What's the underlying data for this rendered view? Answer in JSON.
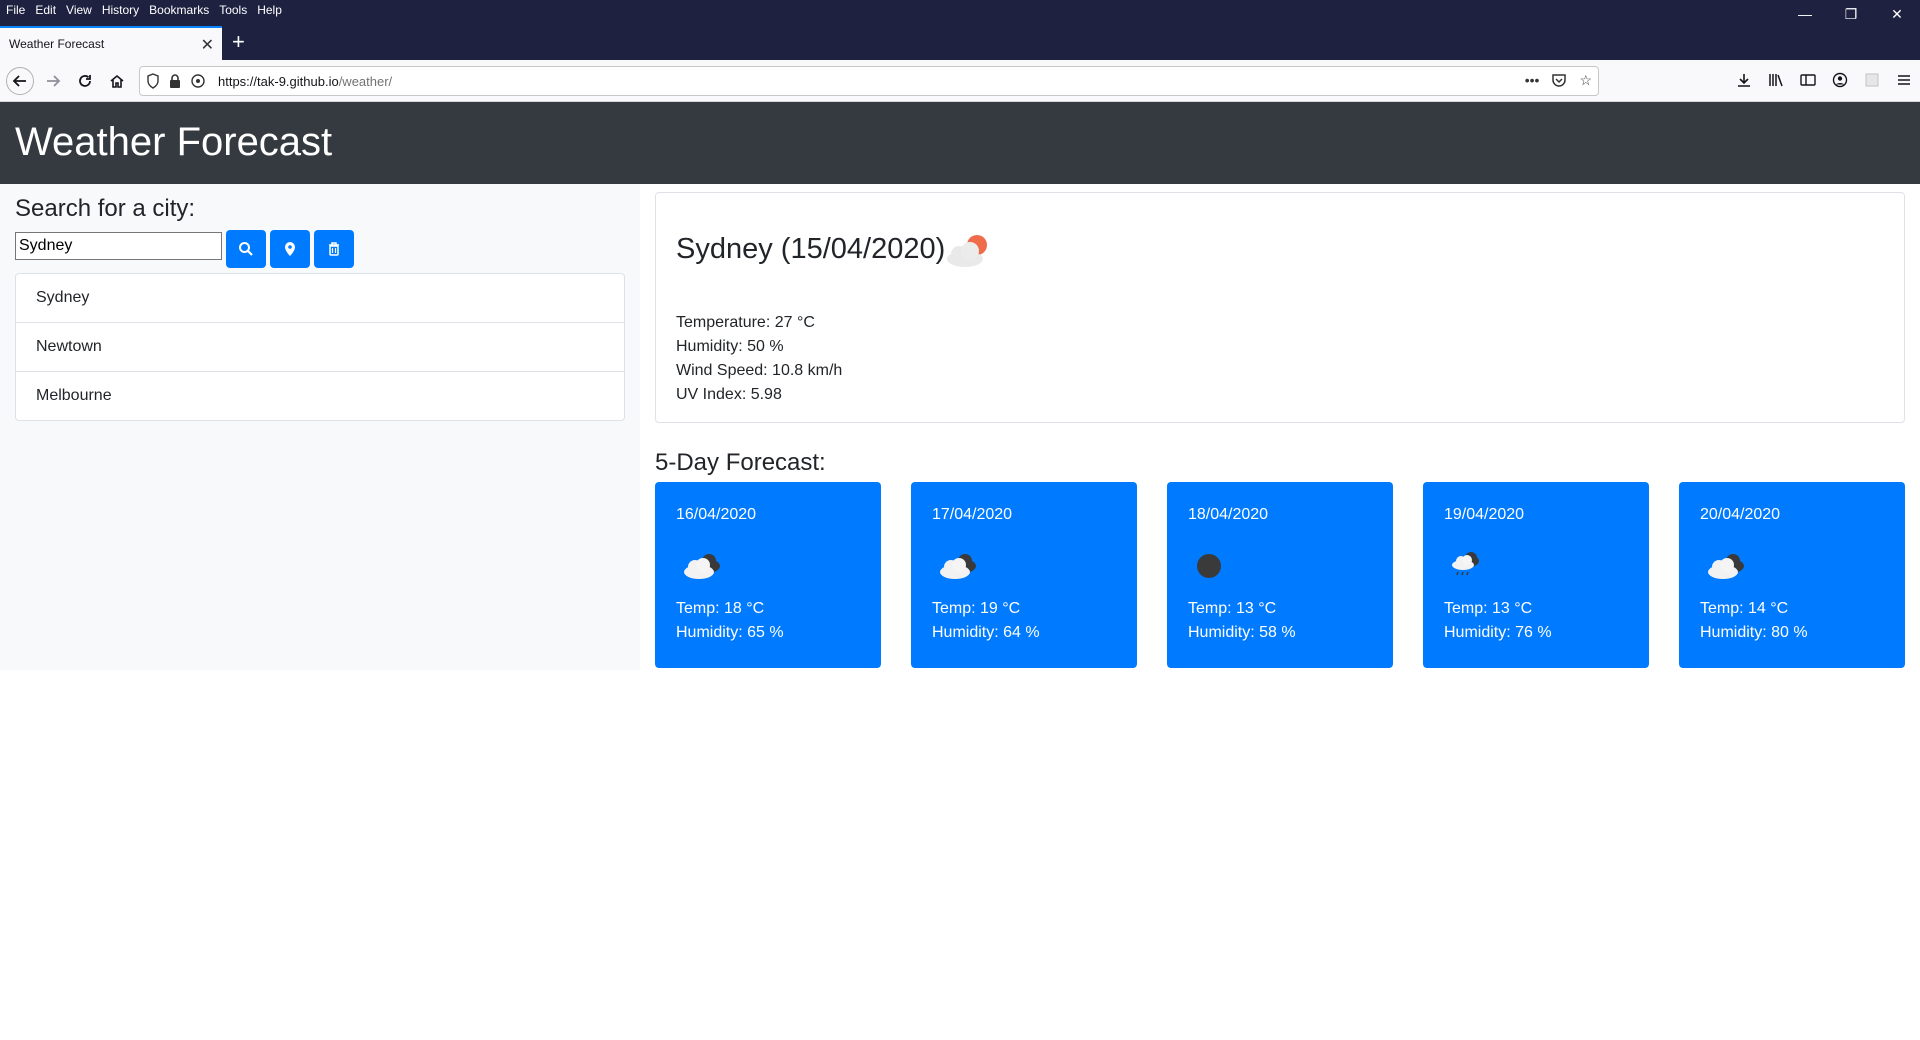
{
  "browser": {
    "menu": [
      "File",
      "Edit",
      "View",
      "History",
      "Bookmarks",
      "Tools",
      "Help"
    ],
    "tab_title": "Weather Forecast",
    "url_domain": "https://tak-9.github.io",
    "url_path": "/weather/"
  },
  "app": {
    "title": "Weather Forecast"
  },
  "search": {
    "label": "Search for a city:",
    "input_value": "Sydney",
    "history": [
      "Sydney",
      "Newtown",
      "Melbourne"
    ]
  },
  "current": {
    "heading": "Sydney (15/04/2020)",
    "icon": "cloud-sun-icon",
    "temperature": "Temperature: 27 °C",
    "humidity": "Humidity: 50 %",
    "wind": "Wind Speed: 10.8 km/h",
    "uv": "UV Index: 5.98"
  },
  "forecast": {
    "title": "5-Day Forecast:",
    "days": [
      {
        "date": "16/04/2020",
        "icon": "broken-clouds-icon",
        "temp": "Temp: 18 °C",
        "humidity": "Humidity: 65 %"
      },
      {
        "date": "17/04/2020",
        "icon": "broken-clouds-icon",
        "temp": "Temp: 19 °C",
        "humidity": "Humidity: 64 %"
      },
      {
        "date": "18/04/2020",
        "icon": "clear-night-icon",
        "temp": "Temp: 13 °C",
        "humidity": "Humidity: 58 %"
      },
      {
        "date": "19/04/2020",
        "icon": "light-rain-icon",
        "temp": "Temp: 13 °C",
        "humidity": "Humidity: 76 %"
      },
      {
        "date": "20/04/2020",
        "icon": "broken-clouds-icon",
        "temp": "Temp: 14 °C",
        "humidity": "Humidity: 80 %"
      }
    ]
  },
  "colors": {
    "header_bg": "#343a40",
    "primary": "#007bff",
    "sidebar_bg": "#f8f9fa"
  }
}
